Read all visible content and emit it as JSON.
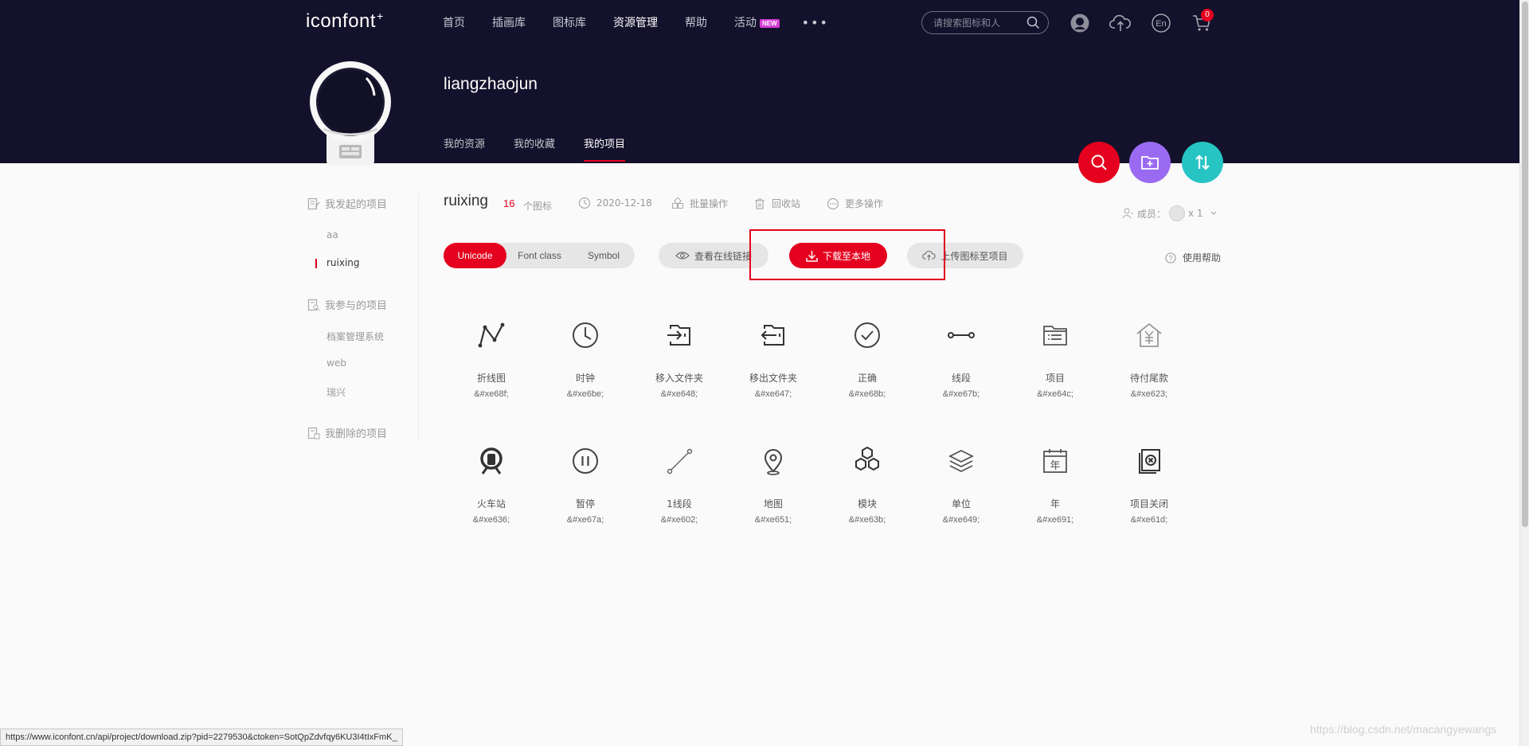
{
  "header": {
    "logo": "iconfont",
    "logo_mark": "+",
    "nav": [
      "首页",
      "插画库",
      "图标库",
      "资源管理",
      "帮助",
      "活动"
    ],
    "nav_active": "资源管理",
    "new_badge": "NEW",
    "more": "•••",
    "search_placeholder": "请搜索图标和人",
    "cart_count": "0"
  },
  "profile": {
    "username": "liangzhaojun",
    "tabs": [
      "我的资源",
      "我的收藏",
      "我的项目"
    ],
    "active_tab": "我的项目"
  },
  "sidebar": {
    "initiated": {
      "title": "我发起的项目",
      "items": [
        "aa",
        "ruixing"
      ]
    },
    "joined": {
      "title": "我参与的项目",
      "items": [
        "档案管理系统",
        "web",
        "瑞兴"
      ]
    },
    "deleted": {
      "title": "我删除的项目"
    },
    "active_item": "ruixing"
  },
  "project": {
    "name": "ruixing",
    "count": "16",
    "count_unit": "个图标",
    "date": "2020-12-18",
    "batch": "批量操作",
    "recycle": "回收站",
    "more": "更多操作",
    "members_label": "成员：",
    "members_count": "x 1"
  },
  "toolbar": {
    "formats": [
      "Unicode",
      "Font class",
      "Symbol"
    ],
    "active_format": "Unicode",
    "view_online": "查看在线链接",
    "download": "下载至本地",
    "upload": "上传图标至项目",
    "help": "使用帮助"
  },
  "icons": [
    {
      "name": "折线图",
      "code": "&#xe68f;",
      "icon": "line-chart-icon"
    },
    {
      "name": "时钟",
      "code": "&#xe6be;",
      "icon": "clock-icon"
    },
    {
      "name": "移入文件夹",
      "code": "&#xe648;",
      "icon": "move-in-folder-icon"
    },
    {
      "name": "移出文件夹",
      "code": "&#xe647;",
      "icon": "move-out-folder-icon"
    },
    {
      "name": "正确",
      "code": "&#xe68b;",
      "icon": "check-circle-icon"
    },
    {
      "name": "线段",
      "code": "&#xe67b;",
      "icon": "line-segment-icon"
    },
    {
      "name": "项目",
      "code": "&#xe64c;",
      "icon": "project-folder-icon"
    },
    {
      "name": "待付尾款",
      "code": "&#xe623;",
      "icon": "pending-payment-icon"
    },
    {
      "name": "火车站",
      "code": "&#xe636;",
      "icon": "train-station-icon"
    },
    {
      "name": "暂停",
      "code": "&#xe67a;",
      "icon": "pause-icon"
    },
    {
      "name": "1线段",
      "code": "&#xe602;",
      "icon": "diagonal-line-icon"
    },
    {
      "name": "地图",
      "code": "&#xe651;",
      "icon": "map-pin-icon"
    },
    {
      "name": "模块",
      "code": "&#xe63b;",
      "icon": "modules-icon"
    },
    {
      "name": "单位",
      "code": "&#xe649;",
      "icon": "layers-icon"
    },
    {
      "name": "年",
      "code": "&#xe691;",
      "icon": "year-calendar-icon"
    },
    {
      "name": "项目关闭",
      "code": "&#xe61d;",
      "icon": "project-close-icon"
    }
  ],
  "status_url": "https://www.iconfont.cn/api/project/download.zip?pid=2279530&ctoken=SotQpZdvfqy6KU3I4tIxFmK_",
  "watermark": "https://blog.csdn.net/macangyewangs",
  "colors": {
    "header_bg": "#13112b",
    "accent_red": "#e4001e",
    "fab_purple": "#9a6bf2",
    "fab_teal": "#27c4c4"
  }
}
